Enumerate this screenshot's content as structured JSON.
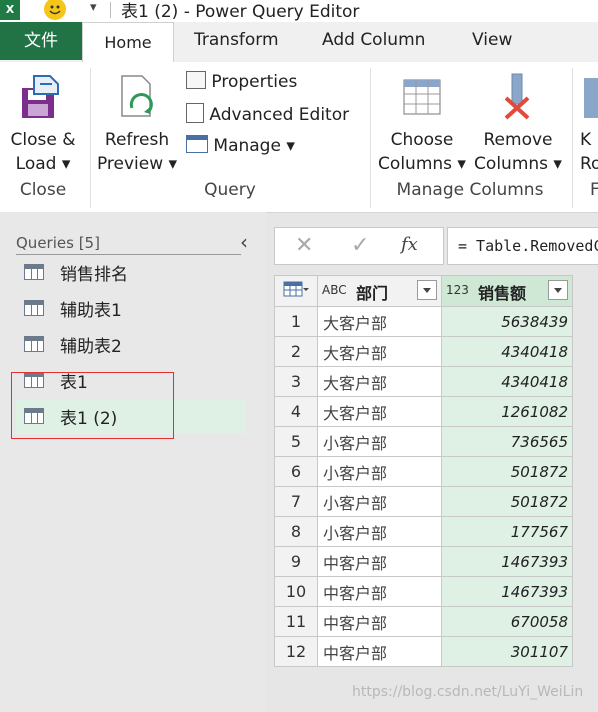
{
  "window": {
    "title": "表1 (2) - Power Query Editor",
    "app_badge": "X"
  },
  "tabs": [
    {
      "label": "文件"
    },
    {
      "label": "Home"
    },
    {
      "label": "Transform"
    },
    {
      "label": "Add Column"
    },
    {
      "label": "View"
    }
  ],
  "ribbon": {
    "close_load": {
      "line1": "Close &",
      "line2": "Load ▾"
    },
    "refresh_preview": {
      "line1": "Refresh",
      "line2": "Preview ▾"
    },
    "properties": "Properties",
    "advanced_editor": "Advanced Editor",
    "manage": "Manage ▾",
    "choose_columns": {
      "line1": "Choose",
      "line2": "Columns ▾"
    },
    "remove_columns": {
      "line1": "Remove",
      "line2": "Columns ▾"
    },
    "cut_k": {
      "line1": "K",
      "line2": "Ro"
    },
    "groups": {
      "close": "Close",
      "query": "Query",
      "manage_columns": "Manage Columns",
      "cut_f": "F"
    }
  },
  "queries_pane": {
    "header": "Queries [5]",
    "items": [
      "销售排名",
      "辅助表1",
      "辅助表2",
      "表1",
      "表1 (2)"
    ],
    "selected_index": 4
  },
  "formula_bar": {
    "cancel": "✕",
    "confirm": "✓",
    "fx": "fx",
    "text": "= Table.RemovedColumns"
  },
  "grid": {
    "columns": [
      {
        "type_icon": "ABC",
        "name": "部门"
      },
      {
        "type_icon": "123",
        "name": "销售额"
      }
    ],
    "rows": [
      {
        "n": "1",
        "dept": "大客户部",
        "value": "5638439"
      },
      {
        "n": "2",
        "dept": "大客户部",
        "value": "4340418"
      },
      {
        "n": "3",
        "dept": "大客户部",
        "value": "4340418"
      },
      {
        "n": "4",
        "dept": "大客户部",
        "value": "1261082"
      },
      {
        "n": "5",
        "dept": "小客户部",
        "value": "736565"
      },
      {
        "n": "6",
        "dept": "小客户部",
        "value": "501872"
      },
      {
        "n": "7",
        "dept": "小客户部",
        "value": "501872"
      },
      {
        "n": "8",
        "dept": "小客户部",
        "value": "177567"
      },
      {
        "n": "9",
        "dept": "中客户部",
        "value": "1467393"
      },
      {
        "n": "10",
        "dept": "中客户部",
        "value": "1467393"
      },
      {
        "n": "11",
        "dept": "中客户部",
        "value": "670058"
      },
      {
        "n": "12",
        "dept": "中客户部",
        "value": "301107"
      }
    ]
  },
  "watermark": "https://blog.csdn.net/LuYi_WeiLin",
  "colors": {
    "excel_green": "#217346",
    "selection_green": "#dff0e4",
    "highlight_red": "#e03030"
  }
}
